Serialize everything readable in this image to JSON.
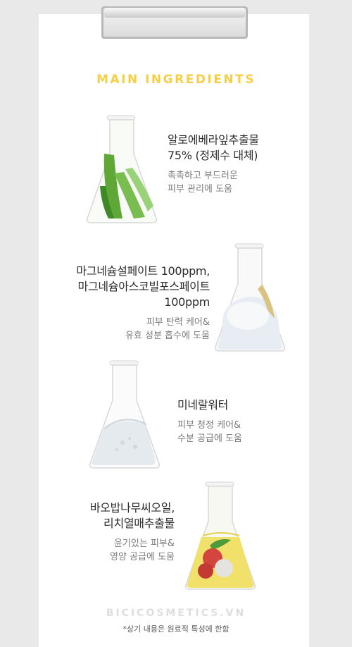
{
  "header": {
    "title": "MAIN INGREDIENTS"
  },
  "ingredients": [
    {
      "name_line1": "알로에베라잎추출물",
      "name_line2": "75% (정제수 대체)",
      "desc_line1": "촉촉하고 부드러운",
      "desc_line2": "피부 관리에 도움",
      "image": "aloe-flask"
    },
    {
      "name_line1": "마그네슘설페이트 100ppm,",
      "name_line2": "마그네슘아스코빌포스페이트",
      "name_line3": "100ppm",
      "desc_line1": "피부 탄력 케어&",
      "desc_line2": "유효 성분 흡수에 도움",
      "image": "salt-flask"
    },
    {
      "name_line1": "미네랄워터",
      "desc_line1": "피부 청정 케어&",
      "desc_line2": "수분 공급에 도움",
      "image": "water-flask"
    },
    {
      "name_line1": "바오밥나무씨오일,",
      "name_line2": "리치열매추출물",
      "desc_line1": "윤기있는 피부&",
      "desc_line2": "영양 공급에 도움",
      "image": "oil-lychee-flask"
    }
  ],
  "footer": {
    "brand": "BICICOSMETICS.VN",
    "note": "*상기 내용은 원료적 특성에 한함"
  },
  "colors": {
    "accent": "#f5cf46",
    "background": "#e9e9e9",
    "card": "#ffffff"
  }
}
